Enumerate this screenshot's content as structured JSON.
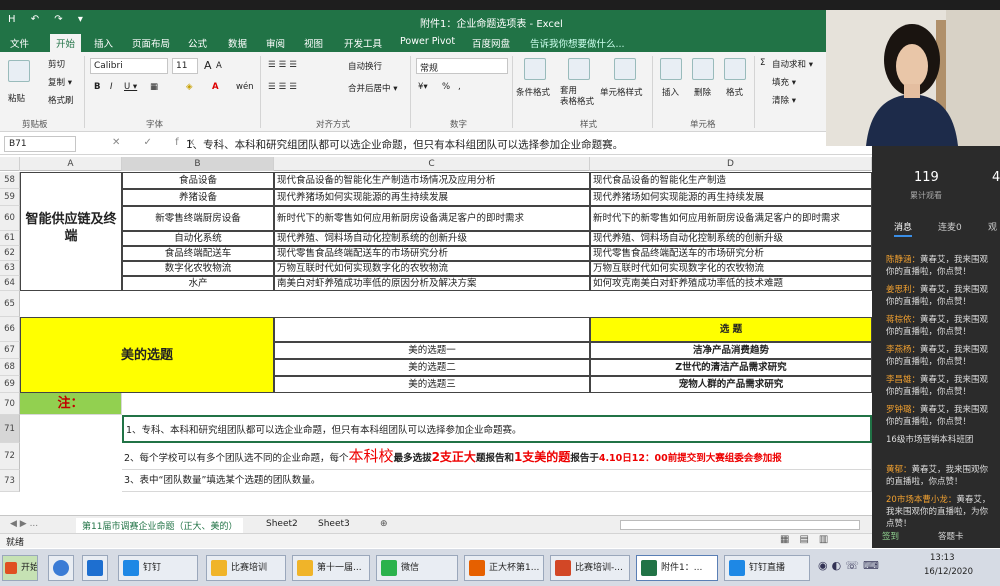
{
  "window": {
    "title": "附件1：企业命题选项表 - Excel",
    "quick_access": "H ↶ ↷ ▾"
  },
  "tabs": [
    "文件",
    "开始",
    "插入",
    "页面布局",
    "公式",
    "数据",
    "审阅",
    "视图",
    "开发工具",
    "Power Pivot",
    "百度网盘"
  ],
  "tell_me": "告诉我你想要做什么...",
  "ribbon": {
    "clipboard": {
      "paste": "粘贴",
      "cut": "剪切",
      "copy": "复制 ▾",
      "format_painter": "格式刷",
      "group": "剪贴板"
    },
    "font": {
      "name": "Calibri",
      "size": "11",
      "group": "字体",
      "bold": "B",
      "italic": "I",
      "underline": "U ▾",
      "grow": "A",
      "shrink": "A",
      "wen": "wén"
    },
    "alignment": {
      "wrap": "自动换行",
      "merge": "合并后居中 ▾",
      "group": "对齐方式"
    },
    "number": {
      "format": "常规",
      "percent": "%",
      "comma": ",",
      "group": "数字"
    },
    "styles": {
      "conditional": "条件格式",
      "table": "套用\n表格格式",
      "cell": "单元格样式",
      "group": "样式"
    },
    "cells": {
      "insert": "插入",
      "delete": "删除",
      "format": "格式",
      "group": "单元格"
    },
    "editing": {
      "autosum": "自动求和 ▾",
      "fill": "填充 ▾",
      "clear": "清除 ▾"
    }
  },
  "formula_bar": {
    "name_box": "B71",
    "fx": "✕ ✓ fx",
    "content": "1、专科、本科和研究组团队都可以选企业命题，但只有本科组团队可以选择参加企业命题赛。"
  },
  "columns": [
    "A",
    "B",
    "C",
    "D"
  ],
  "rows": [
    {
      "n": "58",
      "b": "食品设备",
      "c": "现代食品设备的智能化生产制造市场情况及应用分析",
      "d": "现代食品设备的智能化生产制造"
    },
    {
      "n": "59",
      "b": "养猪设备",
      "c": "现代养猪场如何实现能源的再生持续发展",
      "d": "现代养猪场如何实现能源的再生持续发展"
    },
    {
      "n": "60",
      "b": "新零售终端厨房设备",
      "c": "新时代下的新零售如何应用新厨房设备满足客户的即时需求",
      "d": "新时代下的新零售如何应用新厨房设备满足客户的即时需求"
    },
    {
      "n": "61",
      "b": "自动化系统",
      "c": "现代养殖、饲料场自动化控制系统的创新升级",
      "d": "现代养殖、饲料场自动化控制系统的创新升级"
    },
    {
      "n": "62",
      "b": "食品终端配送车",
      "c": "现代零售食品终端配送车的市场研究分析",
      "d": "现代零售食品终端配送车的市场研究分析"
    },
    {
      "n": "63",
      "b": "数字化农牧物流",
      "c": "万物互联时代如何实现数字化的农牧物流",
      "d": "万物互联时代如何实现数字化的农牧物流"
    },
    {
      "n": "64",
      "b": "水产",
      "c": "南美白对虾养殖成功率低的原因分析及解决方案",
      "d": "如何攻克南美白对虾养殖成功率低的技术难题"
    }
  ],
  "merged_a": "智能供应链及终端",
  "row_nums_lower": [
    "65",
    "66",
    "67",
    "68",
    "69",
    "70",
    "71",
    "72",
    "73"
  ],
  "meide": {
    "label": "美的选题",
    "heading": "选 题",
    "topics": [
      {
        "c": "美的选题一",
        "d": "洁净产品消费趋势"
      },
      {
        "c": "美的选题二",
        "d": "Z世代的清洁产品需求研究"
      },
      {
        "c": "美的选题三",
        "d": "宠物人群的产品需求研究"
      }
    ]
  },
  "notes": {
    "title": "注：",
    "n1": "1、专科、本科和研究组团队都可以选企业命题，但只有本科组团队可以选择参加企业命题赛。",
    "n2a": "2、每个学校可以有多个团队选不同的企业命题，每个",
    "n2b": "本科校",
    "n2c": "最多选拔",
    "n2d": "2支正大",
    "n2e": "题报告和",
    "n2f": "1支美的题",
    "n2g": "报告于",
    "n2h": "4.10日12：00前提交到大赛组委会参加报",
    "n3": "3、表中“团队数量”填选某个选题的团队数量。"
  },
  "sheet_tabs": [
    "第11届市调赛企业命题（正大、美的）",
    "Sheet2",
    "Sheet3",
    "⊕"
  ],
  "status": "就绪",
  "chat": {
    "count": "119",
    "count_label": "累计观看",
    "count2": "4",
    "tabs": [
      "消息",
      "连麦0",
      "观"
    ],
    "messages": [
      {
        "user": "陈静涵：",
        "text": "黄春艾，我来围观你的直播啦，你点赞！"
      },
      {
        "user": "姜思利：",
        "text": "黄春艾，我来围观你的直播啦，你点赞！"
      },
      {
        "user": "蒋棕依：",
        "text": "黄春艾，我来围观你的直播啦，你点赞！"
      },
      {
        "user": "李燕杨：",
        "text": "黄春艾，我来围观你的直播啦，你点赞！"
      },
      {
        "user": "李昌雄：",
        "text": "黄春艾，我来围观你的直播啦，你点赞！"
      },
      {
        "user": "罗钟璐：",
        "text": "黄春艾，我来围观你的直播啦，你点赞！"
      },
      {
        "user": "",
        "text": "16级市场营销本科班团"
      },
      {
        "user": "黄郁：",
        "text": "黄春艾，我来围观你的直播啦，你点赞！"
      },
      {
        "user": "20市场本曹小龙：",
        "text": "黄春艾，我来围观你的直播啦，为你点赞！"
      }
    ],
    "footer": [
      "签到",
      "答题卡"
    ]
  },
  "taskbar": {
    "start": "开始",
    "items": [
      "钉钉",
      "比赛培训",
      "第十一届...",
      "微信",
      "正大杯第1...",
      "比赛培训-...",
      "附件1：...",
      "钉钉直播"
    ],
    "time": "13:13",
    "date": "16/12/2020"
  }
}
